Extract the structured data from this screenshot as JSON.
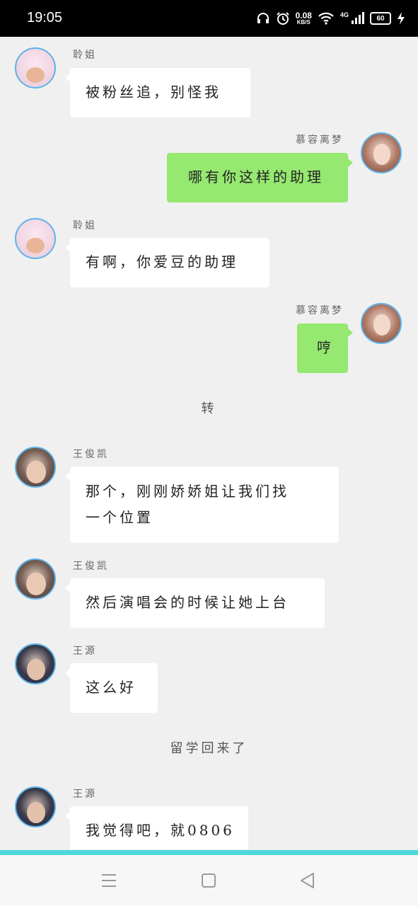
{
  "status_bar": {
    "time": "19:05",
    "net_speed_value": "0.08",
    "net_speed_unit": "KB/S",
    "network_type": "4G",
    "battery_level": "60",
    "icons": [
      "headset-icon",
      "alarm-icon",
      "wifi-icon",
      "signal-icon",
      "battery-icon",
      "charging-icon"
    ]
  },
  "messages": [
    {
      "side": "left",
      "sender": "聆姐",
      "text": "被粉丝追，别怪我"
    },
    {
      "side": "right",
      "sender": "慕容离梦",
      "text": "哪有你这样的助理"
    },
    {
      "side": "left",
      "sender": "聆姐",
      "text": "有啊，你爱豆的助理"
    },
    {
      "side": "right",
      "sender": "慕容离梦",
      "text": "哼"
    },
    {
      "divider": "转"
    },
    {
      "side": "left",
      "sender": "王俊凯",
      "text_lines": [
        "那个，刚刚娇娇姐让我们找",
        "一个位置"
      ]
    },
    {
      "side": "left",
      "sender": "王俊凯",
      "text": "然后演唱会的时候让她上台"
    },
    {
      "side": "left",
      "sender": "王源",
      "text": "这么好"
    },
    {
      "divider": "留学回来了"
    },
    {
      "side": "left",
      "sender": "王源",
      "text": "我觉得吧，就0806"
    }
  ],
  "colors": {
    "background": "#f0f0f0",
    "bubble_left": "#ffffff",
    "bubble_right": "#95e870",
    "avatar_ring": "#5fb3e8",
    "accent_bar": "#4dd8dc"
  },
  "nav_bar": {
    "buttons": [
      "menu-icon",
      "home-icon",
      "back-icon"
    ]
  }
}
